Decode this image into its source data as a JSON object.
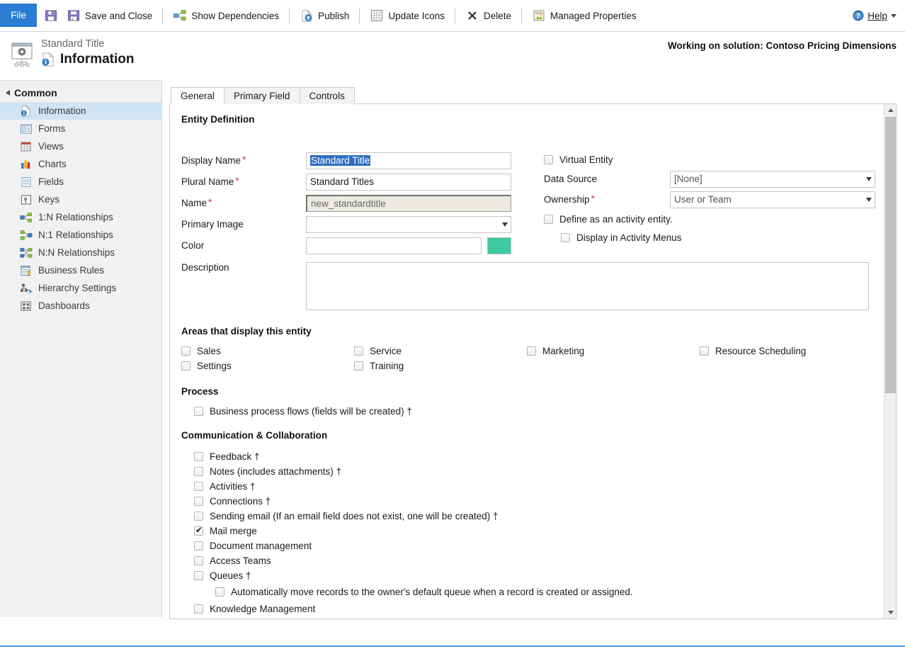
{
  "ribbon": {
    "file_label": "File",
    "buttons": [
      {
        "icon": "save-icon",
        "label": ""
      },
      {
        "icon": "save-and-close-icon",
        "label": "Save and Close"
      },
      {
        "icon": "show-dependencies-icon",
        "label": "Show Dependencies"
      },
      {
        "icon": "publish-icon",
        "label": "Publish"
      },
      {
        "icon": "update-icons-icon",
        "label": "Update Icons"
      },
      {
        "icon": "delete-icon",
        "label": "Delete"
      },
      {
        "icon": "managed-properties-icon",
        "label": "Managed Properties"
      }
    ],
    "help_label": "Help"
  },
  "header": {
    "subtitle": "Standard Title",
    "title": "Information",
    "solution_note": "Working on solution: Contoso Pricing Dimensions"
  },
  "sidebar": {
    "group_label": "Common",
    "items": [
      {
        "label": "Information",
        "icon": "information-icon",
        "active": true
      },
      {
        "label": "Forms",
        "icon": "forms-icon",
        "active": false
      },
      {
        "label": "Views",
        "icon": "views-icon",
        "active": false
      },
      {
        "label": "Charts",
        "icon": "charts-icon",
        "active": false
      },
      {
        "label": "Fields",
        "icon": "fields-icon",
        "active": false
      },
      {
        "label": "Keys",
        "icon": "keys-icon",
        "active": false
      },
      {
        "label": "1:N Relationships",
        "icon": "one-to-many-icon",
        "active": false
      },
      {
        "label": "N:1 Relationships",
        "icon": "many-to-one-icon",
        "active": false
      },
      {
        "label": "N:N Relationships",
        "icon": "many-to-many-icon",
        "active": false
      },
      {
        "label": "Business Rules",
        "icon": "business-rules-icon",
        "active": false
      },
      {
        "label": "Hierarchy Settings",
        "icon": "hierarchy-settings-icon",
        "active": false
      },
      {
        "label": "Dashboards",
        "icon": "dashboards-icon",
        "active": false
      }
    ]
  },
  "tabs": [
    {
      "label": "General",
      "active": true
    },
    {
      "label": "Primary Field",
      "active": false
    },
    {
      "label": "Controls",
      "active": false
    }
  ],
  "form": {
    "entity_definition_heading": "Entity Definition",
    "display_name": {
      "label": "Display Name",
      "required": true,
      "value": "Standard Title",
      "selected": true
    },
    "plural_name": {
      "label": "Plural Name",
      "required": true,
      "value": "Standard Titles"
    },
    "name": {
      "label": "Name",
      "required": true,
      "value": "new_standardtitle",
      "readonly": true
    },
    "primary_image": {
      "label": "Primary Image",
      "value": ""
    },
    "color": {
      "label": "Color",
      "value": "",
      "swatch_hex": "#3ec9a0"
    },
    "description": {
      "label": "Description",
      "value": ""
    },
    "virtual_entity": {
      "label": "Virtual Entity",
      "checked": false
    },
    "data_source": {
      "label": "Data Source",
      "value": "[None]"
    },
    "ownership": {
      "label": "Ownership",
      "required": true,
      "value": "User or Team"
    },
    "define_activity_entity": {
      "label": "Define as an activity entity.",
      "checked": false
    },
    "display_in_activity_menus": {
      "label": "Display in Activity Menus",
      "checked": false
    }
  },
  "areas": {
    "heading": "Areas that display this entity",
    "columns": [
      [
        {
          "label": "Sales",
          "checked": false
        },
        {
          "label": "Settings",
          "checked": false
        }
      ],
      [
        {
          "label": "Service",
          "checked": false
        },
        {
          "label": "Training",
          "checked": false
        }
      ],
      [
        {
          "label": "Marketing",
          "checked": false
        }
      ],
      [
        {
          "label": "Resource Scheduling",
          "checked": false
        }
      ]
    ]
  },
  "process": {
    "heading": "Process",
    "items": [
      {
        "label": "Business process flows (fields will be created) †",
        "checked": false
      }
    ]
  },
  "communication": {
    "heading": "Communication & Collaboration",
    "items": [
      {
        "label": "Feedback †",
        "checked": false,
        "indent": 0
      },
      {
        "label": "Notes (includes attachments) †",
        "checked": false,
        "indent": 0
      },
      {
        "label": "Activities †",
        "checked": false,
        "indent": 0
      },
      {
        "label": "Connections †",
        "checked": false,
        "indent": 0
      },
      {
        "label": "Sending email (If an email field does not exist, one will be created) †",
        "checked": false,
        "indent": 0
      },
      {
        "label": "Mail merge",
        "checked": true,
        "indent": 0
      },
      {
        "label": "Document management",
        "checked": false,
        "indent": 0
      },
      {
        "label": "Access Teams",
        "checked": false,
        "indent": 0
      },
      {
        "label": "Queues †",
        "checked": false,
        "indent": 0
      },
      {
        "label": "Automatically move records to the owner's default queue when a record is created or assigned.",
        "checked": false,
        "indent": 1
      },
      {
        "label": "Knowledge Management",
        "checked": false,
        "indent": 0
      }
    ]
  },
  "colors": {
    "file_tab_blue": "#2b7cd3",
    "sidebar_active": "#cfe5f5",
    "required_red": "#d0363b",
    "accent_swatch": "#3ec9a0"
  }
}
